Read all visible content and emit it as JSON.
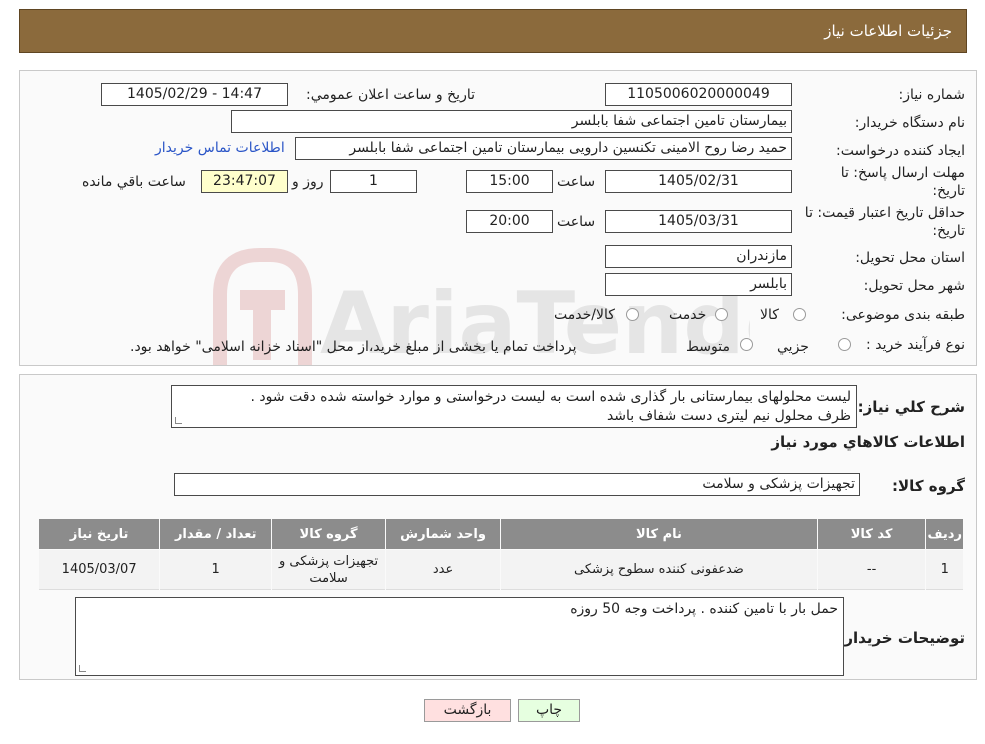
{
  "header": {
    "title": "جزئیات اطلاعات نیاز"
  },
  "form": {
    "need_number_label": "شماره نیاز:",
    "need_number": "1105006020000049",
    "announce_label": "تاریخ و ساعت اعلان عمومي:",
    "announce_value": "1405/02/29 - 14:47",
    "buyer_label": "نام دستگاه خریدار:",
    "buyer_value": "بیمارستان تامین اجتماعی شفا بابلسر",
    "creator_label": "ایجاد کننده درخواست:",
    "creator_value": "حمید رضا روح الامینی تکنسین دارویی بیمارستان تامین اجتماعی شفا بابلسر",
    "contact_link": "اطلاعات تماس خریدار",
    "deadline_label_1": "مهلت ارسال پاسخ: تا",
    "deadline_label_2": "تاریخ:",
    "deadline_date": "1405/02/31",
    "hour_label": "ساعت",
    "deadline_time": "15:00",
    "days_value": "1",
    "days_label": "روز و",
    "remaining_time": "23:47:07",
    "remaining_label": "ساعت باقي مانده",
    "validity_label_1": "حداقل تاریخ اعتبار قیمت: تا",
    "validity_label_2": "تاریخ:",
    "validity_date": "1405/03/31",
    "validity_time": "20:00",
    "province_label": "استان محل تحویل:",
    "province_value": "مازندران",
    "city_label": "شهر محل تحویل:",
    "city_value": "بابلسر",
    "category_label": "طبقه بندی موضوعی:",
    "category_options": [
      "کالا",
      "خدمت",
      "کالا/خدمت"
    ],
    "process_label": "نوع فرآیند خرید :",
    "process_options": [
      "جزیي",
      "متوسط"
    ],
    "process_note": "پرداخت تمام یا بخشی از مبلغ خرید،از محل \"اسناد خزانه اسلامی\" خواهد بود."
  },
  "details": {
    "description_label": "شرح کلي نیاز:",
    "description_line1": "لیست محلولهای بیمارستانی بار گذاری شده است به لیست درخواستی و موارد خواسته شده دقت شود .",
    "description_line2": "ظرف محلول نیم لیتری دست شفاف باشد",
    "goods_info_title": "اطلاعات کالاهاي مورد نیاز",
    "goods_group_label": "گروه کالا:",
    "goods_group_value": "تجهیزات پزشکی و سلامت",
    "table_headers": [
      "ردیف",
      "کد کالا",
      "نام کالا",
      "واحد شمارش",
      "گروه کالا",
      "تعداد / مقدار",
      "تاریخ نیاز"
    ],
    "table_rows": [
      [
        "1",
        "--",
        "ضدعفونی کننده سطوح پزشکی",
        "عدد",
        "تجهیزات پزشکی و سلامت",
        "1",
        "1405/03/07"
      ]
    ],
    "buyer_notes_label": "توضیحات خریدار:",
    "buyer_notes_value": "حمل بار با تامین کننده . پرداخت وجه 50 روزه"
  },
  "buttons": {
    "print": "چاپ",
    "back": "بازگشت"
  },
  "watermark": {
    "text": "AriaTender.neT"
  },
  "colors": {
    "header_bg": "#8b6a3c",
    "link": "#2a55c7",
    "table_header": "#8c8c8c",
    "back_button": "#ffe0e0",
    "print_button": "#e6ffe0"
  }
}
